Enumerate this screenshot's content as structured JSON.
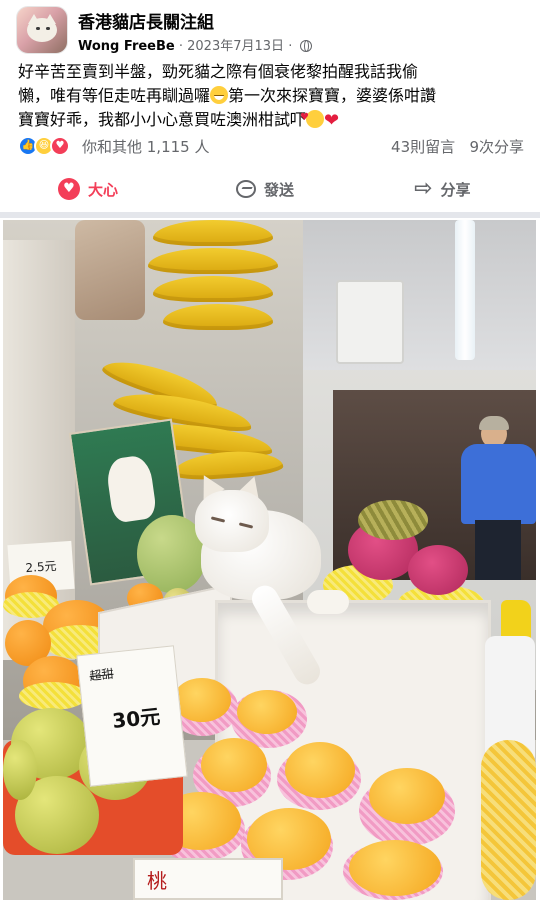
{
  "header": {
    "page_name": "香港貓店長關注組",
    "author": "Wong FreeBe",
    "date": "2023年7月13日",
    "separator": "·"
  },
  "post": {
    "line1": "好辛苦至賣到半盤，勁死貓之際有個衰佬黎拍醒我話我偷",
    "line2a": "懶，唯有等佢走咗再瞓過囉",
    "line2b": "第一次來探寶寶，婆婆係咁讚",
    "line3a": "寶寶好乖，我都小小心意買咗澳洲柑試吓"
  },
  "reactions": {
    "summary": "你和其他 1,115 人",
    "comments": "43則留言",
    "shares": "9次分享"
  },
  "actions": {
    "love": "大心",
    "send": "發送",
    "share": "分享"
  },
  "photo": {
    "price_tag_left": "2.5元",
    "price_tag_main_top": "超甜",
    "price_tag_main_price": "30元",
    "bottom_sign": "桃"
  },
  "colors": {
    "love": "#f33e58",
    "like": "#1877f2",
    "muted": "#65676b",
    "divider": "#e4e6eb"
  },
  "icons": [
    "avatar",
    "globe-icon",
    "like-reaction-icon",
    "haha-reaction-icon",
    "love-reaction-icon",
    "heart-icon",
    "send-icon",
    "share-icon"
  ]
}
